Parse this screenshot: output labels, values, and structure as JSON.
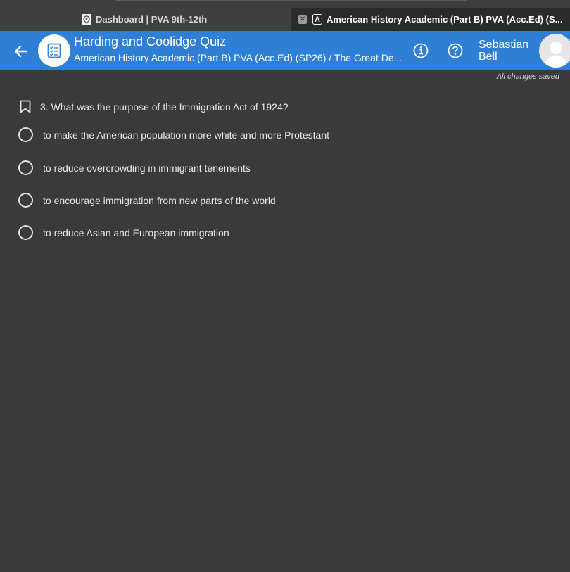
{
  "browser": {
    "tabs": [
      {
        "label": "Dashboard | PVA 9th-12th",
        "icon": "pin-icon",
        "active": false
      },
      {
        "label": "American History Academic (Part B) PVA (Acc.Ed) (S...",
        "icon": "a-icon",
        "close_icon": "close-icon",
        "active": true
      }
    ]
  },
  "header": {
    "title": "Harding and Coolidge Quiz",
    "subtitle": "American History Academic (Part B) PVA (Acc.Ed) (SP26) / The Great De...",
    "user_first": "Sebastian",
    "user_last": "Bell",
    "accent_color": "#2f7fd6"
  },
  "status": {
    "saved_text": "All changes saved"
  },
  "question": {
    "text": "3. What was the purpose of the Immigration Act of 1924?",
    "options": [
      "to make the American population more white and more Protestant",
      "to reduce overcrowding in immigrant tenements",
      "to encourage immigration from new parts of the world",
      "to reduce Asian and European immigration"
    ]
  }
}
